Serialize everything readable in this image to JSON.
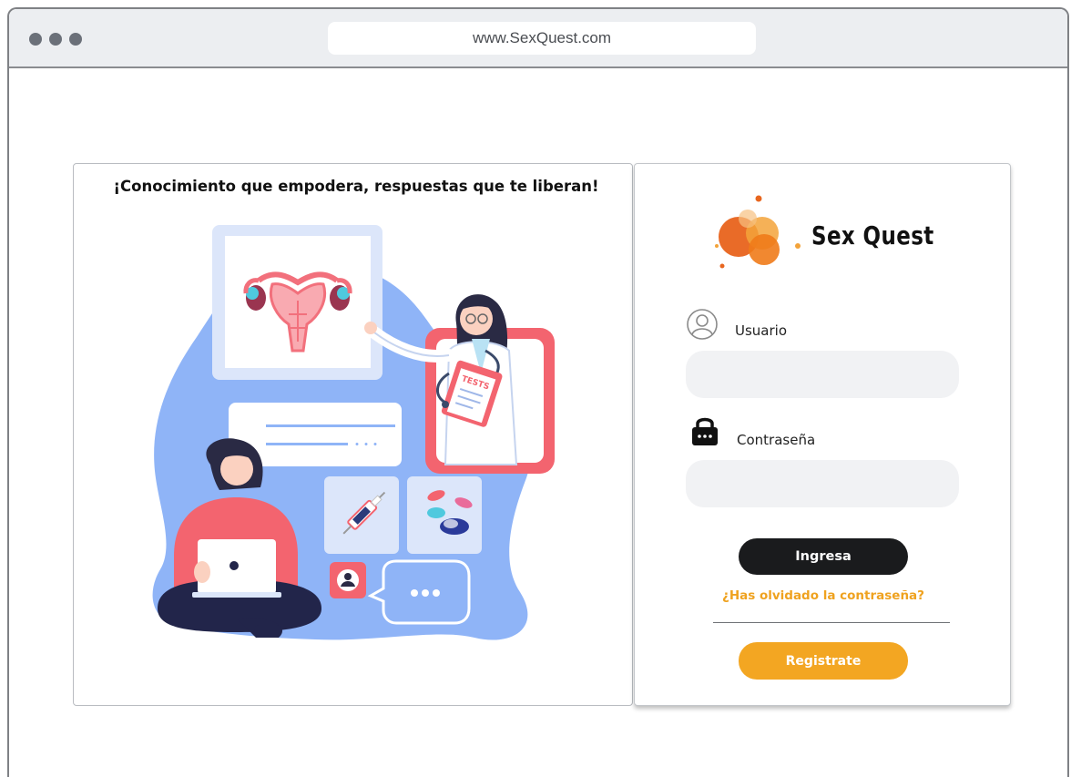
{
  "browser": {
    "url": "www.SexQuest.com"
  },
  "hero": {
    "headline": "¡Conocimiento que empodera, respuestas que te liberan!",
    "illustration_text": "TESTS"
  },
  "login": {
    "brand": "Sex Quest",
    "username_label": "Usuario",
    "username_value": "",
    "password_label": "Contraseña",
    "password_value": "",
    "login_button": "Ingresa",
    "forgot_link": "¿Has olvidado la contraseña?",
    "register_button": "Registrate"
  },
  "icons": {
    "window_controls": [
      "dot",
      "dot",
      "dot"
    ],
    "user_icon": "user-circle-icon",
    "lock_icon": "lock-icon"
  },
  "colors": {
    "accent_orange": "#f3a622",
    "dark_button": "#1a1b1d",
    "link_orange": "#efa21f",
    "blob_blue": "#8fb4f7",
    "coral": "#f0707d"
  }
}
